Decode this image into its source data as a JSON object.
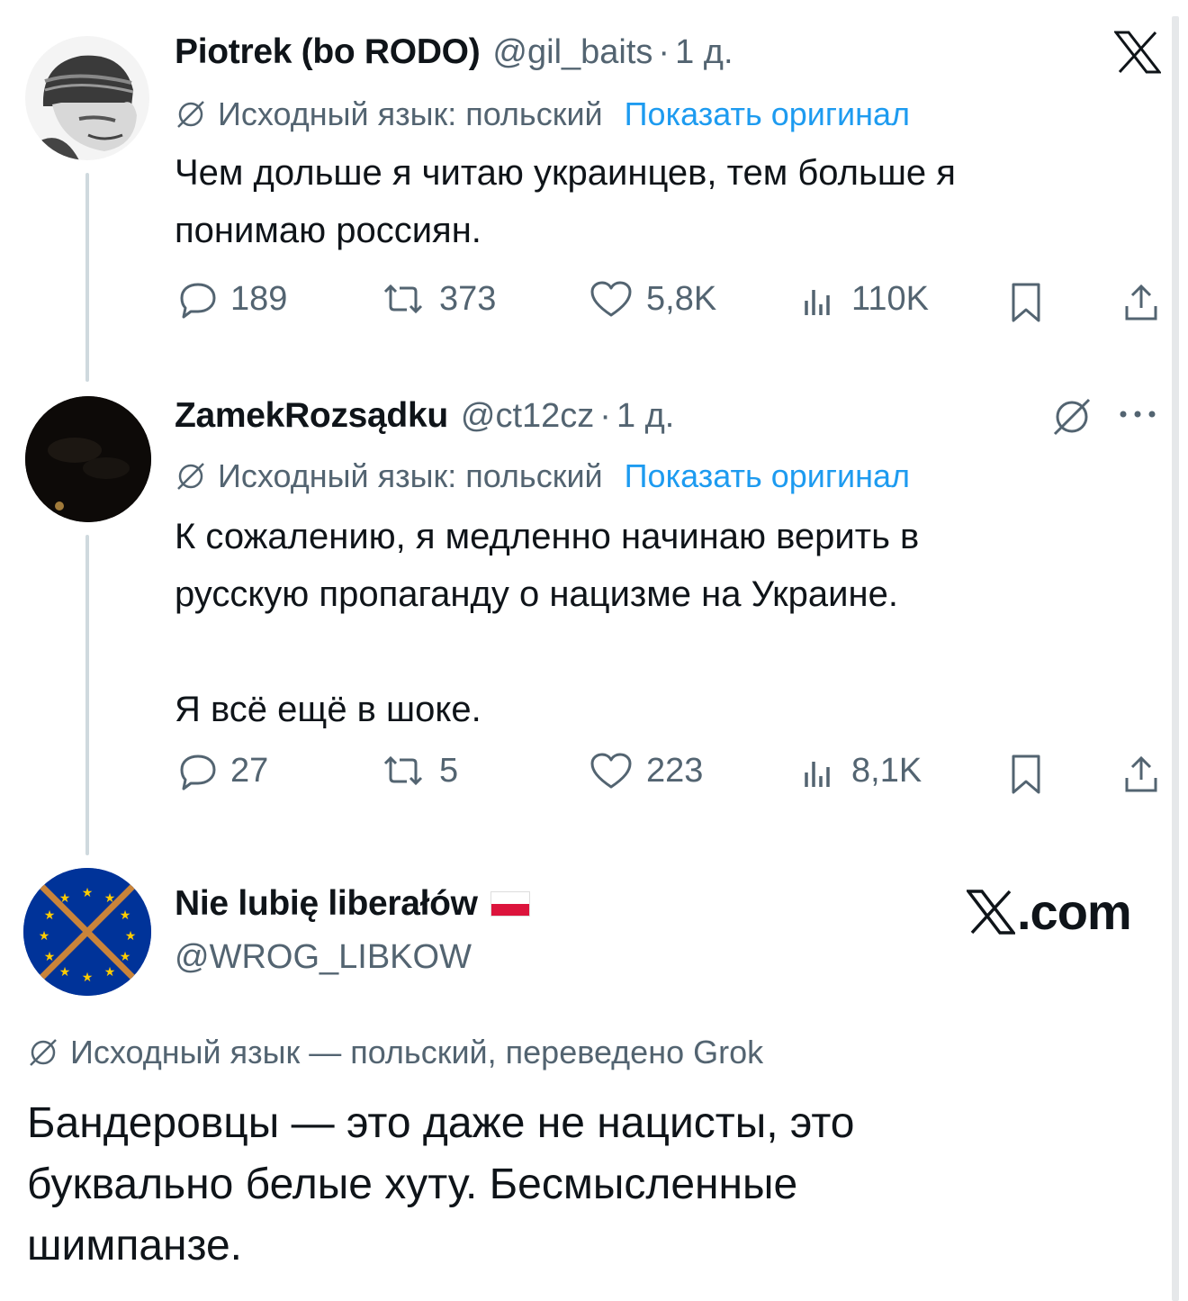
{
  "tweets": [
    {
      "name": "Piotrek (bo RODO)",
      "handle": "@gil_baits",
      "dot": "·",
      "time": "1 д.",
      "translation_note": "Исходный язык: польский",
      "show_original": "Показать оригинал",
      "text": "Чем дольше я читаю украинцев, тем больше я\nпонимаю россиян.",
      "replies": "189",
      "reposts": "373",
      "likes": "5,8K",
      "views": "110K"
    },
    {
      "name": "ZamekRozsądku",
      "handle": "@ct12cz",
      "dot": "·",
      "time": "1 д.",
      "translation_note": "Исходный язык: польский",
      "show_original": "Показать оригинал",
      "text": "К сожалению, я медленно начинаю верить в\nрусскую пропаганду о нацизме на Украине.\n\nЯ всё ещё в шоке.",
      "replies": "27",
      "reposts": "5",
      "likes": "223",
      "views": "8,1K"
    }
  ],
  "quote": {
    "name": "Nie lubię liberałów",
    "handle": "@WROG_LIBKOW",
    "brand": ".com",
    "translation_note": "Исходный язык — польский, переведено Grok",
    "text": "Бандеровцы — это даже не нацисты, это\nбуквально белые хуту. Бесмысленные\nшимпанзе."
  },
  "colors": {
    "text": "#0f1419",
    "muted": "#536471",
    "link": "#1d9bf0",
    "eu_blue": "#003399",
    "eu_star": "#ffcc00",
    "cross": "#c9843a"
  },
  "icons": [
    "x-logo-icon",
    "no-translate-icon",
    "reply-icon",
    "repost-icon",
    "like-icon",
    "views-icon",
    "bookmark-icon",
    "share-icon",
    "more-icon",
    "flag-poland-icon"
  ]
}
